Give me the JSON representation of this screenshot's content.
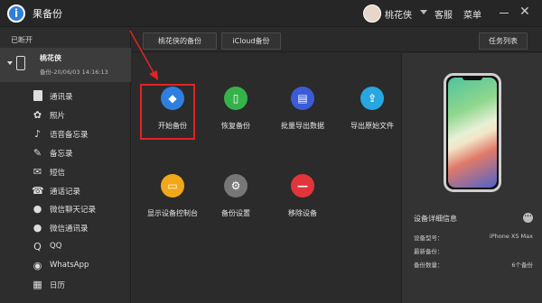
{
  "app": {
    "title": "果备份",
    "logo_glyph": "i"
  },
  "header": {
    "username": "桃花侠",
    "service_label": "客服",
    "menu_label": "菜单",
    "close_glyph": "✕"
  },
  "sidebar": {
    "status": "已断开",
    "device": {
      "name": "桃花侠",
      "subtitle": "备份-20/06/03 14:16:13"
    },
    "items": [
      {
        "label": "通讯录",
        "icon": "contacts-icon"
      },
      {
        "label": "照片",
        "icon": "photos-icon"
      },
      {
        "label": "语音备忘录",
        "icon": "microphone-icon"
      },
      {
        "label": "备忘录",
        "icon": "notes-icon"
      },
      {
        "label": "短信",
        "icon": "message-icon"
      },
      {
        "label": "通话记录",
        "icon": "phone-call-icon"
      },
      {
        "label": "微信聊天记录",
        "icon": "wechat-icon"
      },
      {
        "label": "微信通讯录",
        "icon": "wechat-contacts-icon"
      },
      {
        "label": "QQ",
        "icon": "qq-icon"
      },
      {
        "label": "WhatsApp",
        "icon": "whatsapp-icon"
      },
      {
        "label": "日历",
        "icon": "calendar-icon"
      }
    ]
  },
  "toolbar": {
    "tabs": [
      "桃花侠的备份",
      "iCloud备份"
    ],
    "task_list": "任务列表"
  },
  "actions": [
    {
      "label": "开始备份",
      "icon": "layers-icon",
      "color": "#2f7fe0"
    },
    {
      "label": "恢复备份",
      "icon": "phone-restore-icon",
      "color": "#36b24a"
    },
    {
      "label": "批量导出数据",
      "icon": "export-data-icon",
      "color": "#3b5cd6"
    },
    {
      "label": "导出原始文件",
      "icon": "upload-file-icon",
      "color": "#27a6df"
    },
    {
      "label": "显示设备控制台",
      "icon": "console-icon",
      "color": "#f1a71a"
    },
    {
      "label": "备份设置",
      "icon": "settings-gear-icon",
      "color": "#777777"
    },
    {
      "label": "移除设备",
      "icon": "remove-icon",
      "color": "#e2343b"
    }
  ],
  "device_panel": {
    "heading": "设备详细信息",
    "more_glyph": "···",
    "rows": [
      {
        "label": "设备型号：",
        "value": "iPhone XS Max"
      },
      {
        "label": "最新备份：",
        "value": ""
      },
      {
        "label": "备份数量：",
        "value": "6个备份"
      }
    ]
  },
  "colors": {
    "highlight": "#e32323",
    "accent": "#2f7fd8"
  }
}
